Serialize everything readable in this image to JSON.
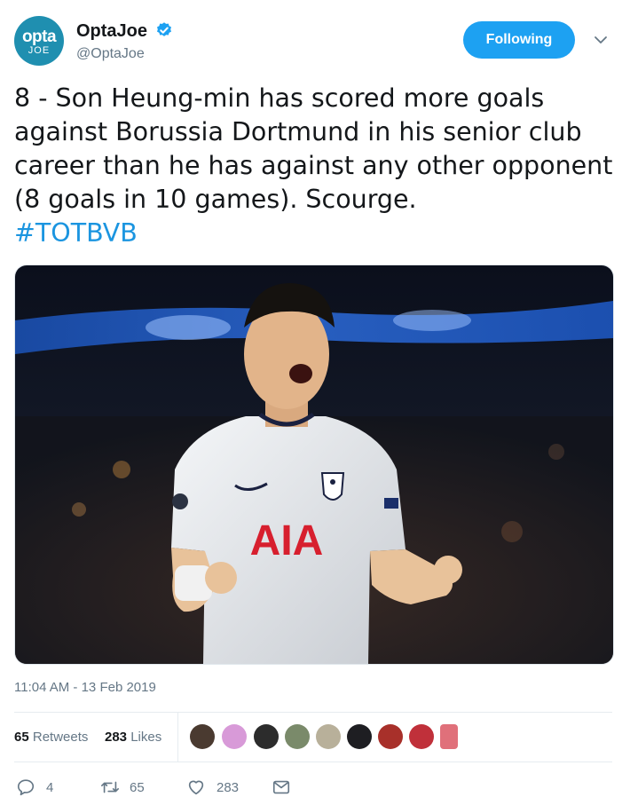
{
  "account": {
    "avatar_line1": "opta",
    "avatar_line2": "JOE",
    "name": "OptaJoe",
    "handle": "@OptaJoe",
    "follow_label": "Following"
  },
  "tweet": {
    "text": "8 - Son Heung-min has scored more goals against Borussia Dortmund in his senior club career than he has against any other opponent (8 goals in 10 games). Scourge.",
    "hashtag": "#TOTBVB",
    "timestamp": "11:04 AM - 13 Feb 2019"
  },
  "media": {
    "shirt_sponsor": "AIA"
  },
  "stats": {
    "retweets_count": "65",
    "retweets_label": "Retweets",
    "likes_count": "283",
    "likes_label": "Likes"
  },
  "actions": {
    "replies": "4",
    "retweets": "65",
    "likes": "283"
  },
  "colors": {
    "accent": "#1da1f2",
    "hashtag": "#1b95e0",
    "muted": "#657786"
  },
  "icons": [
    "verified-badge-icon",
    "chevron-down-icon",
    "reply-icon",
    "retweet-icon",
    "heart-icon",
    "message-icon"
  ]
}
